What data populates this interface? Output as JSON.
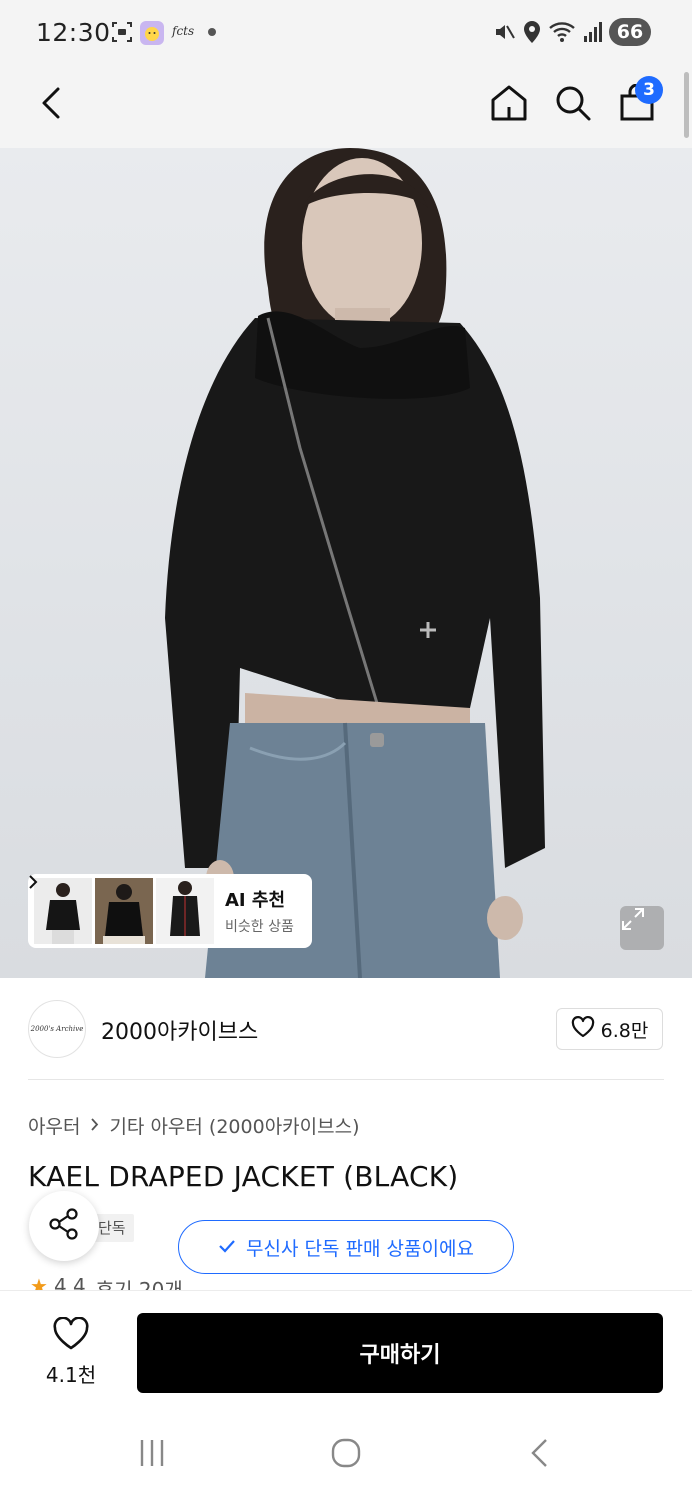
{
  "status_bar": {
    "time": "12:30",
    "battery": "66",
    "icons": [
      "screenshot-icon",
      "app-face-icon",
      "app-brand-icon",
      "dot-icon",
      "mute-vibrate-icon",
      "location-icon",
      "wifi-icon",
      "signal-icon",
      "battery-icon"
    ]
  },
  "app_bar": {
    "icons": [
      "back-icon",
      "home-icon",
      "search-icon",
      "cart-icon"
    ],
    "cart_count": "3"
  },
  "ai_recommend": {
    "title": "AI 추천",
    "subtitle": "비슷한 상품"
  },
  "brand": {
    "logo_text": "2000's Archive",
    "name": "2000아카이브스",
    "likes": "6.8만"
  },
  "product": {
    "breadcrumb": [
      "아우터",
      "기타 아우터 (2000아카이브스)"
    ],
    "title": "KAEL DRAPED JACKET (BLACK)",
    "tag": "단독",
    "exclusive_notice": "무신사 단독 판매 상품이에요",
    "rating": "4.4",
    "reviews": "후기 20개"
  },
  "action_bar": {
    "wish_count": "4.1천",
    "buy_label": "구매하기"
  },
  "colors": {
    "accent_blue": "#1f6bff",
    "buy_button": "#000000",
    "star": "#f29b1a"
  }
}
